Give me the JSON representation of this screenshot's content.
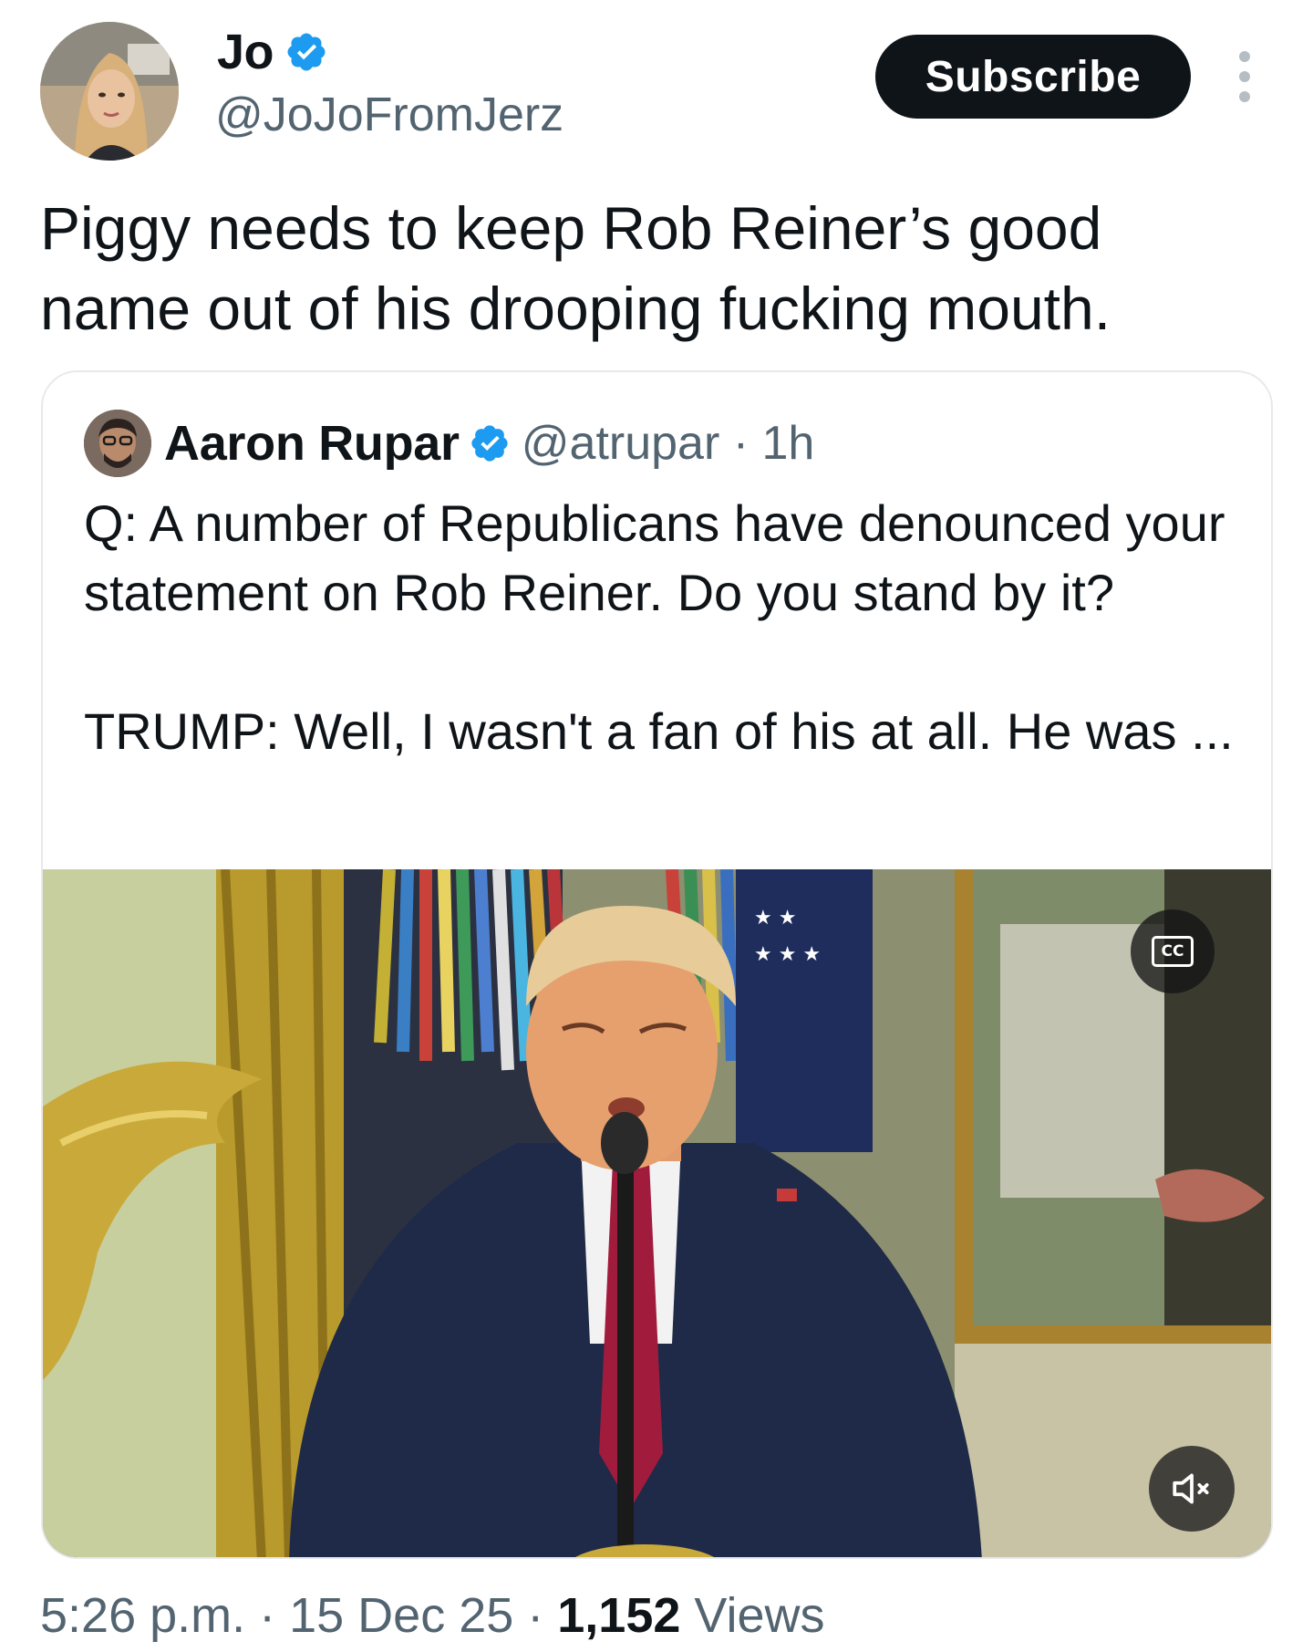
{
  "tweet": {
    "author": {
      "name": "Jo",
      "handle": "@JoJoFromJerz",
      "verified": true
    },
    "subscribe_label": "Subscribe",
    "text": "Piggy needs to keep Rob Reiner’s good name out of his drooping fucking mouth.",
    "quoted": {
      "author_name": "Aaron Rupar",
      "handle_time": "@atrupar · 1h",
      "verified": true,
      "text": "Q: A number of Republicans have denounced your statement on Rob Reiner. Do you stand by it?\n\nTRUMP: Well, I wasn't a fan of his at all. He was ...",
      "video": {
        "captions_icon": "closed-captions-icon",
        "mute_icon": "speaker-muted-icon"
      }
    },
    "meta": {
      "time_date": "5:26 p.m. · 15 Dec 25 · ",
      "views_count": "1,152",
      "views_label": " Views"
    }
  },
  "colors": {
    "verified_blue": "#1d9bf0",
    "text": "#0f1419",
    "secondary": "#536471",
    "button_bg": "#0f1419"
  }
}
